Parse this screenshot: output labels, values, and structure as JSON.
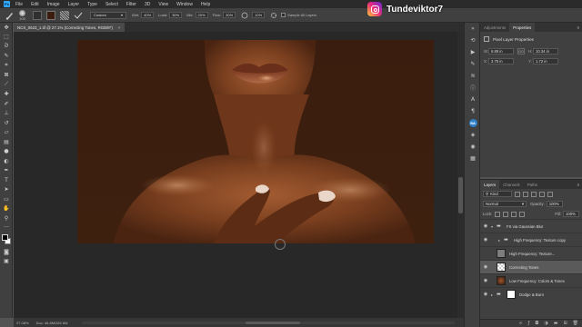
{
  "app": {
    "logo_text": "Ps"
  },
  "menu": [
    "File",
    "Edit",
    "Image",
    "Layer",
    "Type",
    "Select",
    "Filter",
    "3D",
    "View",
    "Window",
    "Help"
  ],
  "watermark": {
    "handle": "Tundeviktor7"
  },
  "options": {
    "brush_size": "100",
    "mode_value": "Custom",
    "mode_label": "Mode",
    "opacity_label": "Wet:",
    "opacity_value": "40%",
    "load_label": "Load:",
    "load_value": "30%",
    "mix_label": "Mix:",
    "mix_value": "20%",
    "flow_label": "Flow:",
    "flow_value": "30%",
    "smoothing_value": "10%",
    "sample_label": "Sample All Layers"
  },
  "document": {
    "tab_title": "NCS_0623_1.tif @ 27.1% (Correcting Tones, RGB/8*)",
    "close": "×"
  },
  "status": {
    "zoom": "27.08%",
    "doc_size": "Doc: 46.8M/282.6M"
  },
  "properties": {
    "tabs": [
      "Adjustments",
      "Properties"
    ],
    "active_tab": "Properties",
    "title": "Pixel Layer Properties",
    "w_label": "W:",
    "w_value": "6.89 in",
    "go_label": "GO",
    "h_label": "H:",
    "h_value": "10.34 in",
    "x_label": "X:",
    "x_value": "3.75 in",
    "y_label": "Y:",
    "y_value": "1.72 in"
  },
  "layers_panel": {
    "tabs": [
      "Layers",
      "Channels",
      "Paths"
    ],
    "active_tab": "Layers",
    "kind_label": "Kind",
    "blend_mode": "Normal",
    "opacity_label": "Opacity:",
    "opacity_value": "100%",
    "lock_label": "Lock:",
    "fill_label": "Fill:",
    "fill_value": "100%",
    "layers": [
      {
        "name": "FS via Gaussian Blur",
        "type": "group"
      },
      {
        "name": "High Frequency: Texture copy",
        "type": "group-inner"
      },
      {
        "name": "High Frequency: Texture...",
        "type": "layer"
      },
      {
        "name": "Correcting Tones",
        "type": "layer",
        "selected": true
      },
      {
        "name": "Low Frequency: Colors & Tones",
        "type": "layer"
      },
      {
        "name": "Dodge & Burn",
        "type": "group"
      }
    ]
  },
  "colors": {
    "accent": "#31a8ff",
    "canvas_bg": "#282828",
    "panel_bg": "#404040",
    "skin": "#8a4b27"
  }
}
